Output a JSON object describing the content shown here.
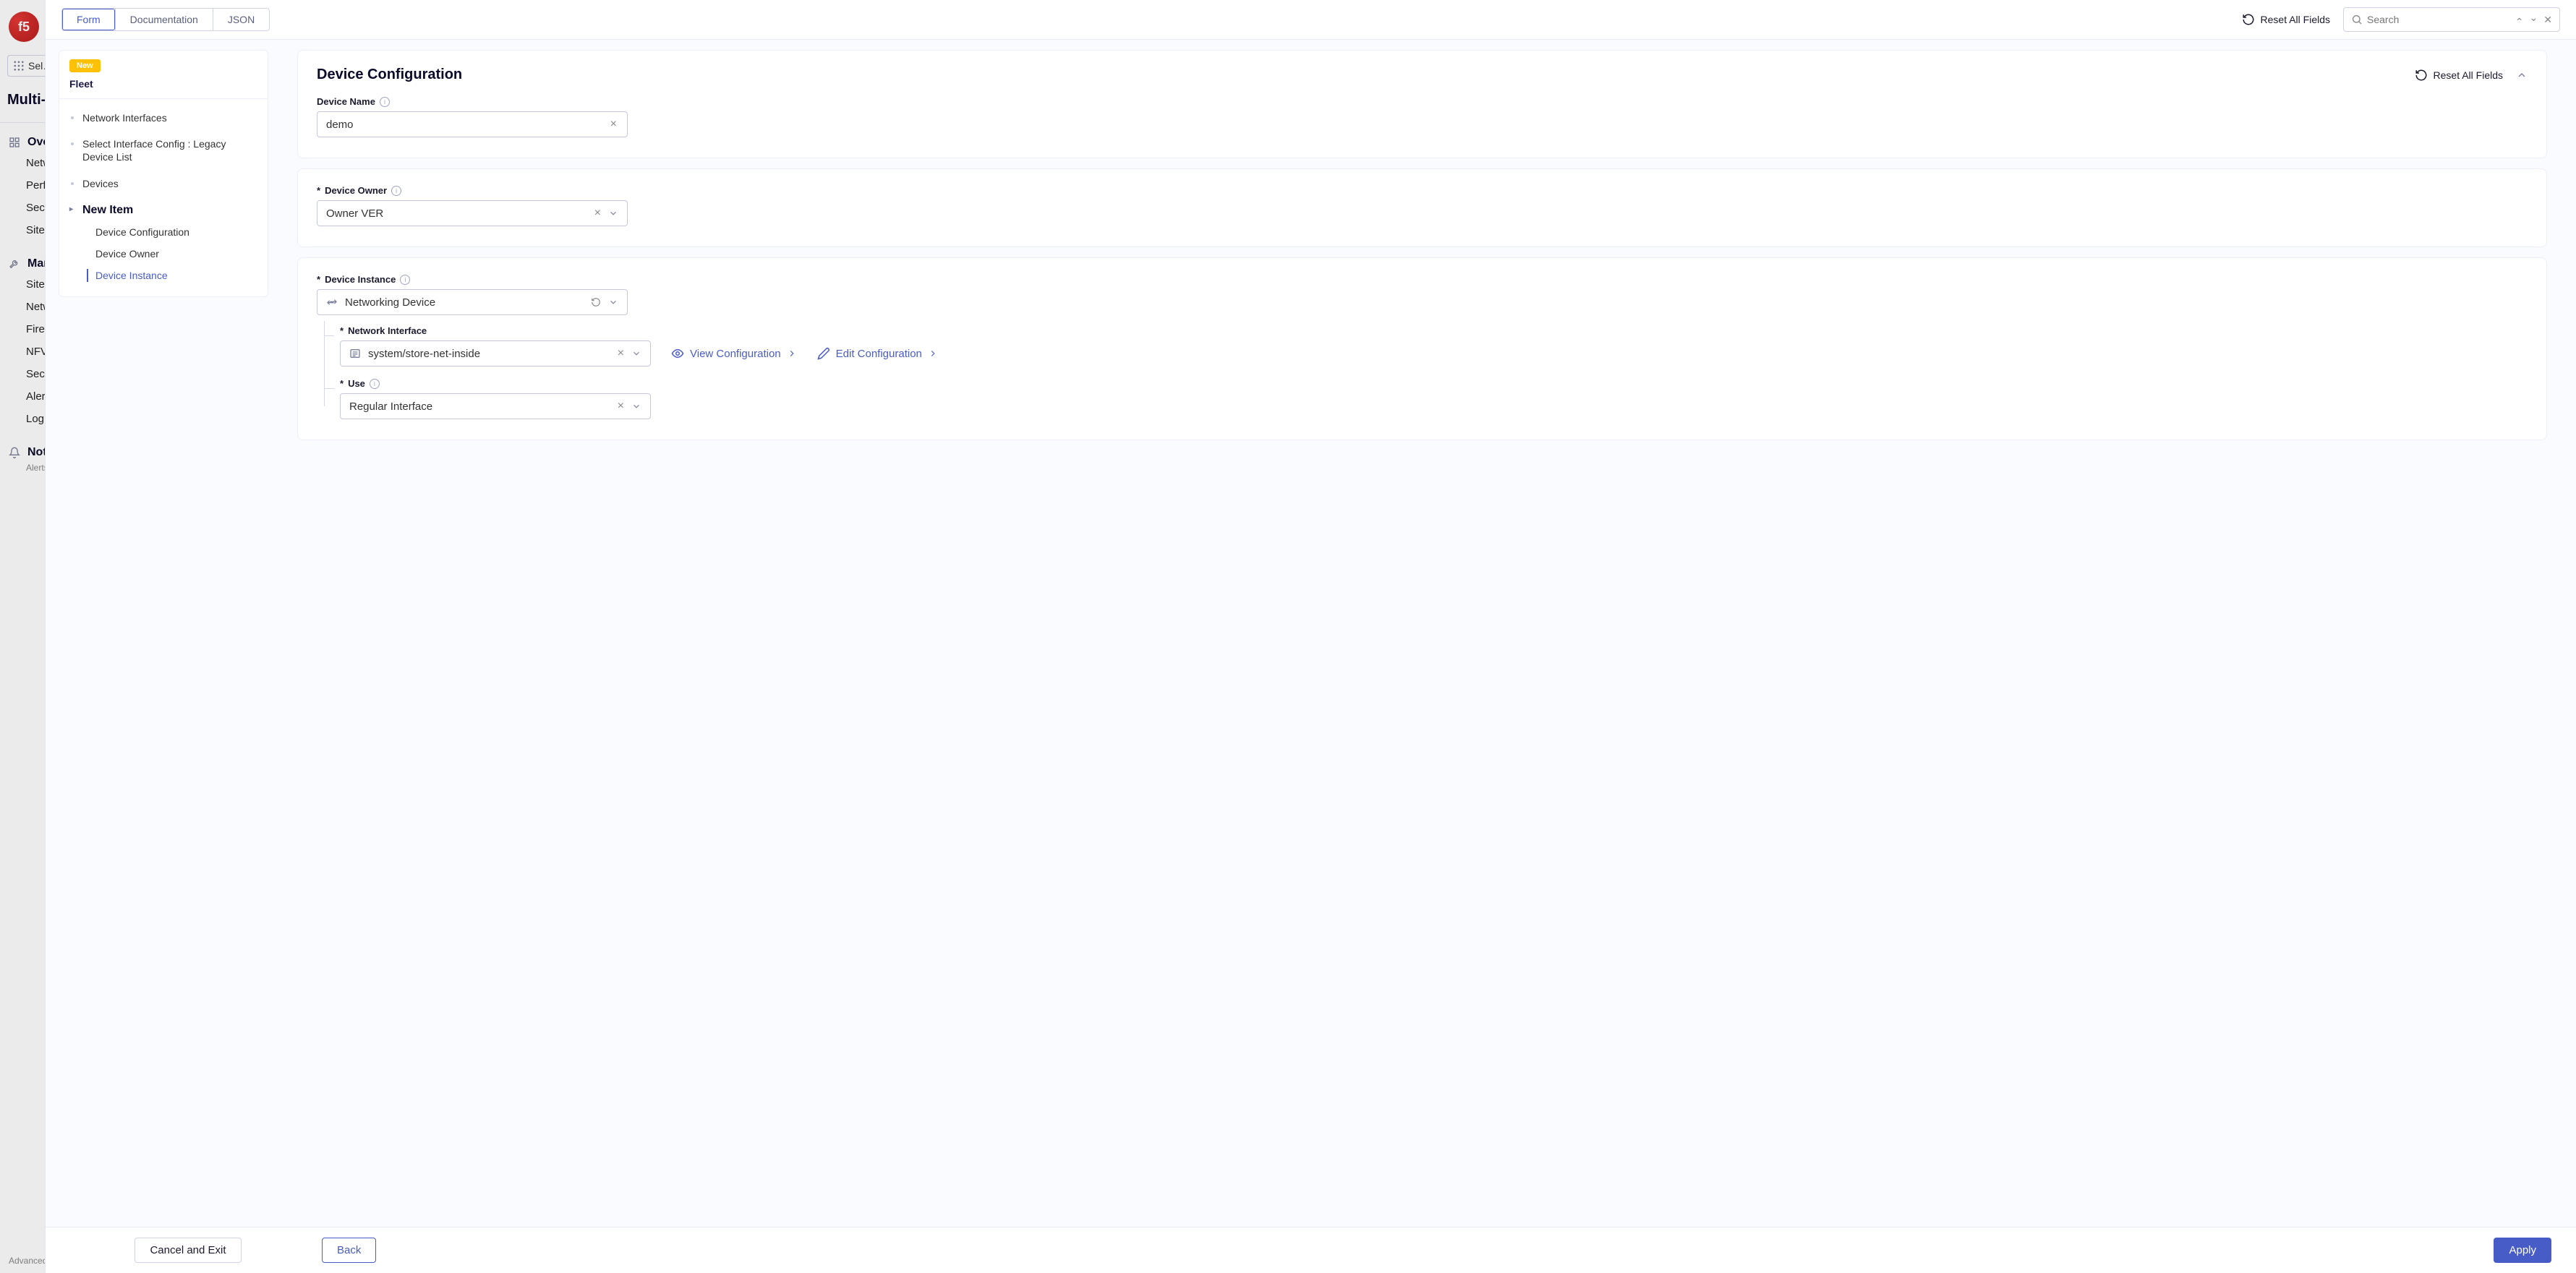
{
  "backdrop": {
    "logo_text": "f5",
    "selector": "Sel…",
    "title": "Multi-C… Connec…",
    "groups": [
      {
        "head": "Ove…",
        "icon": "grid",
        "items": [
          "Netw…",
          "Perfo…",
          "Secu…",
          "Sites…"
        ]
      },
      {
        "head": "Man…",
        "icon": "wrench",
        "items": [
          "Site …",
          "Netw…",
          "Firew…",
          "NFV …",
          "Secr…",
          "Alert…",
          "Log …"
        ]
      },
      {
        "head": "Noti…",
        "icon": "bell",
        "items": [],
        "sub": "Alerts…"
      }
    ],
    "footer": "Advanced …"
  },
  "topbar": {
    "tabs": [
      "Form",
      "Documentation",
      "JSON"
    ],
    "active_tab_index": 0,
    "reset_label": "Reset All Fields",
    "search_placeholder": "Search"
  },
  "tree": {
    "badge": "New",
    "head": "Fleet",
    "items": [
      "Network Interfaces",
      "Select Interface Config : Legacy Device List",
      "Devices"
    ],
    "new_label": "New Item",
    "subs": [
      "Device Configuration",
      "Device Owner",
      "Device Instance"
    ],
    "active_sub_index": 2
  },
  "form": {
    "card1": {
      "title": "Device Configuration",
      "reset": "Reset All Fields",
      "device_name_label": "Device Name",
      "device_name_value": "demo"
    },
    "card2": {
      "owner_label": "Device Owner",
      "owner_value": "Owner VER"
    },
    "card3": {
      "instance_label": "Device Instance",
      "instance_value": "Networking Device",
      "ni_label": "Network Interface",
      "ni_value": "system/store-net-inside",
      "view_cfg": "View Configuration",
      "edit_cfg": "Edit Configuration",
      "use_label": "Use",
      "use_value": "Regular Interface"
    }
  },
  "footer": {
    "cancel": "Cancel and Exit",
    "back": "Back",
    "apply": "Apply"
  }
}
